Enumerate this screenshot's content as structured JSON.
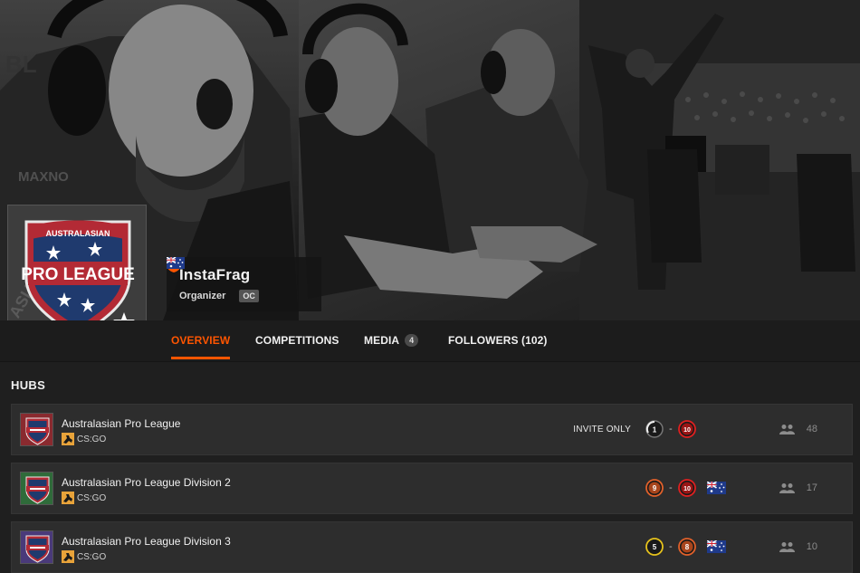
{
  "organizer": {
    "name": "InstaFrag",
    "role": "Organizer",
    "region_tag": "OC",
    "flags": [
      "new-zealand-flag",
      "australia-flag"
    ],
    "logo": {
      "top_text": "AUSTRALASIAN",
      "main_text": "PRO LEAGUE"
    }
  },
  "tabs": [
    {
      "label": "OVERVIEW",
      "active": true
    },
    {
      "label": "COMPETITIONS"
    },
    {
      "label": "MEDIA",
      "count": "4"
    },
    {
      "label": "FOLLOWERS (102)"
    }
  ],
  "hubs_section": {
    "title": "HUBS",
    "hubs": [
      {
        "name": "Australasian Pro League",
        "game": "CS:GO",
        "invite": "INVITE ONLY",
        "skill_min": "1",
        "skill_max": "10",
        "flag": "",
        "members": "48",
        "thumb_color": "#8a2a2f"
      },
      {
        "name": "Australasian Pro League Division 2",
        "game": "CS:GO",
        "invite": "",
        "skill_min": "9",
        "skill_max": "10",
        "flag": "australia-flag",
        "members": "17",
        "thumb_color": "#2f6b3a"
      },
      {
        "name": "Australasian Pro League Division 3",
        "game": "CS:GO",
        "invite": "",
        "skill_min": "5",
        "skill_max": "8",
        "flag": "australia-flag",
        "members": "10",
        "thumb_color": "#4a3a7a"
      }
    ]
  },
  "colors": {
    "accent": "#ff5500",
    "background": "#1f1f1f",
    "row_background": "#2d2d2d"
  }
}
